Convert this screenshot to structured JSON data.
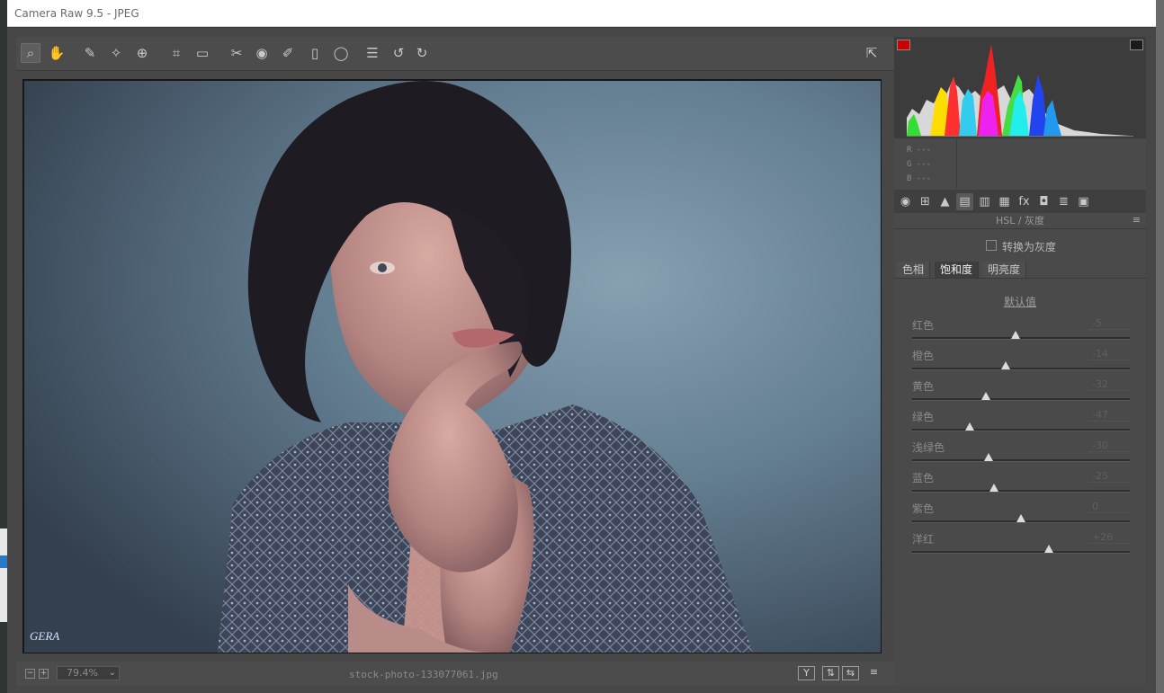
{
  "window": {
    "title": "Camera Raw 9.5 -  JPEG"
  },
  "toolbar": {
    "tools": [
      {
        "name": "zoom-tool",
        "glyph": "⌕"
      },
      {
        "name": "hand-tool",
        "glyph": "✋"
      },
      {
        "name": "white-balance-tool",
        "glyph": "✎"
      },
      {
        "name": "color-sampler-tool",
        "glyph": "✧"
      },
      {
        "name": "targeted-adjustment-tool",
        "glyph": "⊕"
      },
      {
        "name": "crop-tool",
        "glyph": "⌗"
      },
      {
        "name": "straighten-tool",
        "glyph": "▭"
      },
      {
        "name": "spot-removal-tool",
        "glyph": "✂"
      },
      {
        "name": "red-eye-tool",
        "glyph": "◉"
      },
      {
        "name": "adjustment-brush-tool",
        "glyph": "✐"
      },
      {
        "name": "graduated-filter-tool",
        "glyph": "▯"
      },
      {
        "name": "radial-filter-tool",
        "glyph": "◯"
      },
      {
        "name": "preferences-tool",
        "glyph": "☰"
      },
      {
        "name": "rotate-left-tool",
        "glyph": "↺"
      },
      {
        "name": "rotate-right-tool",
        "glyph": "↻"
      }
    ],
    "fullscreen_glyph": "⇱"
  },
  "status": {
    "zoom": "79.4%",
    "filename": "stock-photo-133077061.jpg",
    "zoom_out": "−",
    "zoom_in": "+",
    "btn_y": "Y",
    "btn_swap": "⇅",
    "btn_copy": "⇆",
    "btn_settings": "≡"
  },
  "rgb": {
    "r": "R  ---",
    "g": "G  ---",
    "b": "B  ---"
  },
  "panel_tabs": [
    {
      "name": "basic-tab-icon",
      "glyph": "◉"
    },
    {
      "name": "tone-curve-tab-icon",
      "glyph": "⊞"
    },
    {
      "name": "detail-tab-icon",
      "glyph": "▲"
    },
    {
      "name": "hsl-tab-icon",
      "glyph": "▤"
    },
    {
      "name": "split-toning-tab-icon",
      "glyph": "▥"
    },
    {
      "name": "lens-tab-icon",
      "glyph": "▦"
    },
    {
      "name": "effects-tab-icon",
      "glyph": "fx"
    },
    {
      "name": "camera-calibration-tab-icon",
      "glyph": "◘"
    },
    {
      "name": "presets-tab-icon",
      "glyph": "≣"
    },
    {
      "name": "snapshots-tab-icon",
      "glyph": "▣"
    }
  ],
  "hsl": {
    "panel_title": "HSL / 灰度",
    "convert_gray": "转换为灰度",
    "subtabs": [
      "色相",
      "饱和度",
      "明亮度"
    ],
    "active_subtab": 1,
    "defaults": "默认值",
    "sliders": [
      {
        "label": "红色",
        "value": "-5",
        "level": -5
      },
      {
        "label": "橙色",
        "value": "-14",
        "level": -14
      },
      {
        "label": "黄色",
        "value": "-32",
        "level": -32
      },
      {
        "label": "绿色",
        "value": "-47",
        "level": -47
      },
      {
        "label": "浅绿色",
        "value": "-30",
        "level": -30
      },
      {
        "label": "蓝色",
        "value": "-25",
        "level": -25
      },
      {
        "label": "紫色",
        "value": "0",
        "level": 0
      },
      {
        "label": "洋红",
        "value": "+26",
        "level": 26
      }
    ]
  },
  "photo": {
    "watermark": "GERA"
  },
  "colors": {
    "dialog_bg": "#474747",
    "panel_bg": "#4a4a4a",
    "clip_shadow": "#cc0000",
    "clip_highlight": "#1b1b1b"
  }
}
